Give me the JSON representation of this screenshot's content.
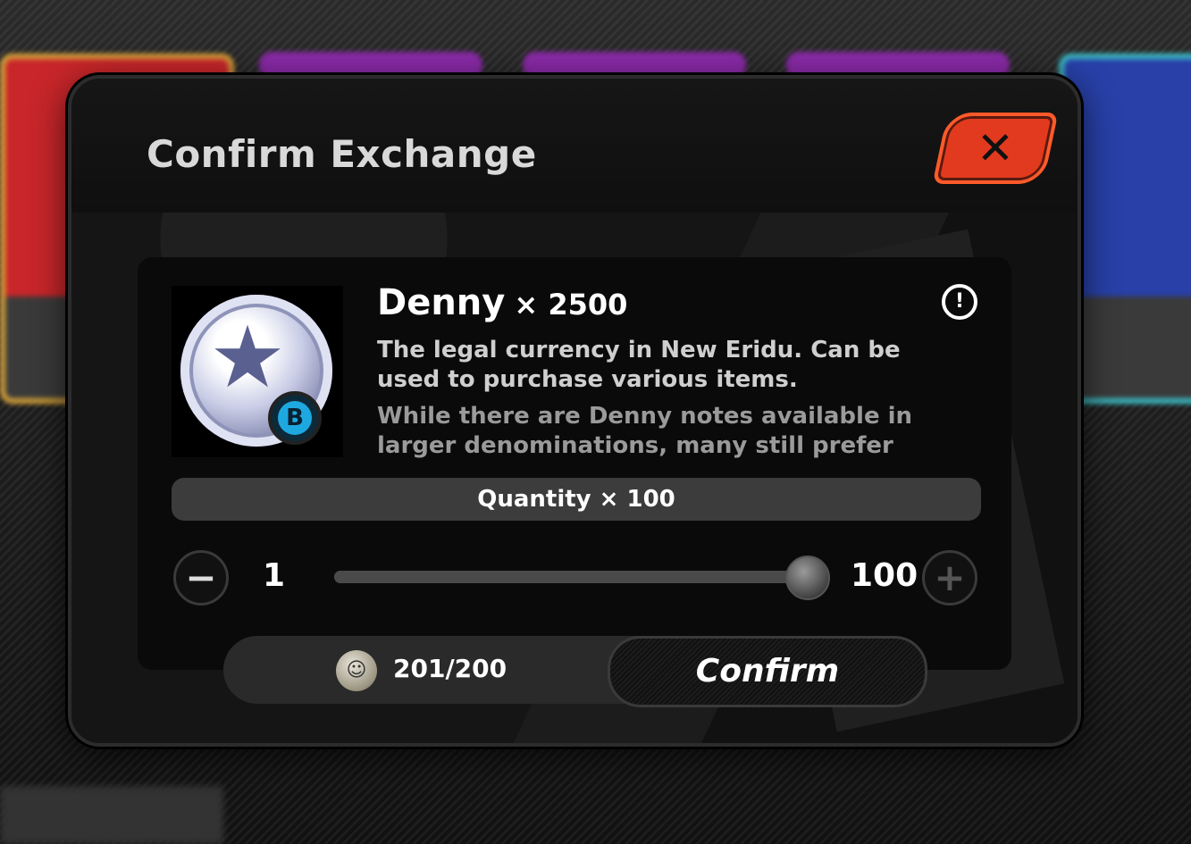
{
  "dialog": {
    "title": "Confirm Exchange",
    "close_symbol": "✕"
  },
  "item": {
    "name": "Denny",
    "amount": "× 2500",
    "icon": "denny-coin-icon",
    "rank": "B",
    "info_symbol": "!",
    "description": "The legal currency in New Eridu. Can be used to purchase various items.",
    "lore": "While there are Denny notes available in larger denominations, many still prefer"
  },
  "quantity": {
    "label": "Quantity × 100",
    "min": "1",
    "max": "100",
    "value": 100,
    "fraction": 1.0,
    "minus_symbol": "−",
    "plus_symbol": "+"
  },
  "cost": {
    "text": "201/200",
    "icon": "token-coin-icon"
  },
  "confirm": {
    "label": "Confirm"
  },
  "colors": {
    "close_button": "#e23a1e",
    "rank_badge": "#1ea8e0"
  }
}
